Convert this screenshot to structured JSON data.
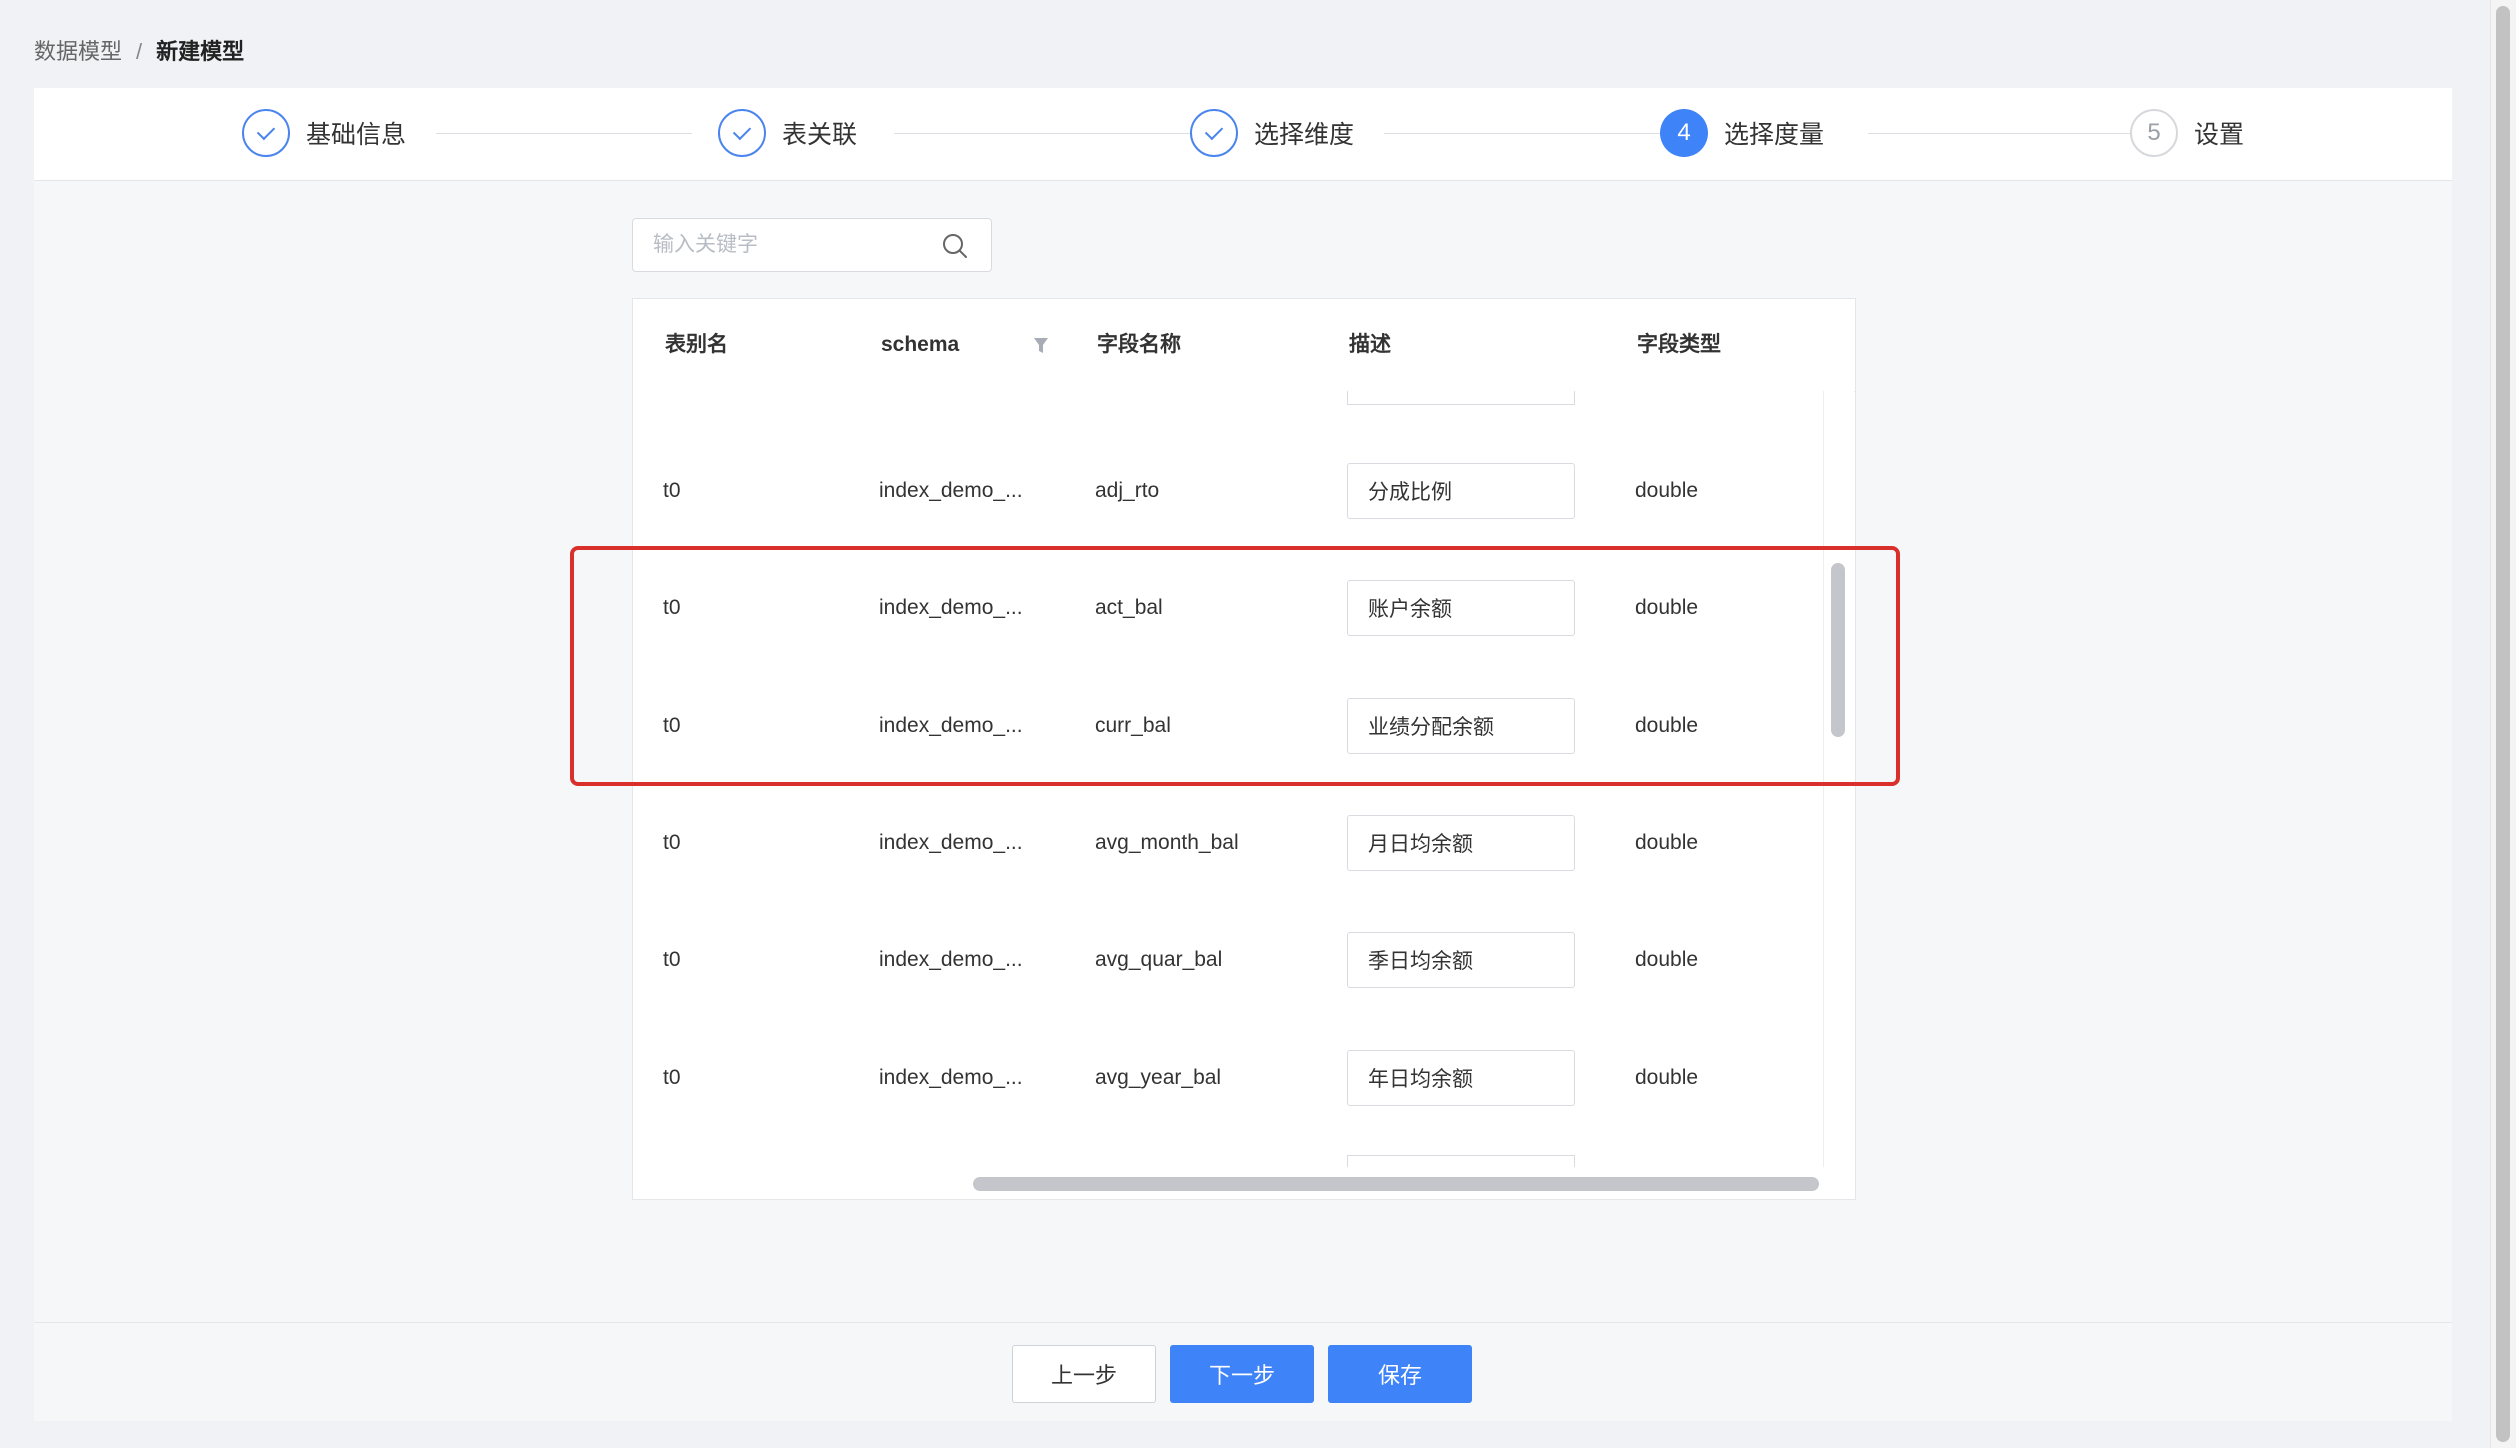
{
  "breadcrumb": {
    "parent": "数据模型",
    "separator": "/",
    "current": "新建模型"
  },
  "steps": [
    {
      "number": "1",
      "label": "基础信息",
      "state": "done"
    },
    {
      "number": "2",
      "label": "表关联",
      "state": "done"
    },
    {
      "number": "3",
      "label": "选择维度",
      "state": "done"
    },
    {
      "number": "4",
      "label": "选择度量",
      "state": "active"
    },
    {
      "number": "5",
      "label": "设置",
      "state": "todo"
    }
  ],
  "search": {
    "placeholder": "输入关键字",
    "value": ""
  },
  "table": {
    "headers": [
      "表别名",
      "schema",
      "字段名称",
      "描述",
      "字段类型"
    ],
    "rows": [
      {
        "alias": "t0",
        "schema": "index_demo_...",
        "field": "adj_rto",
        "desc": "分成比例",
        "type": "double"
      },
      {
        "alias": "t0",
        "schema": "index_demo_...",
        "field": "act_bal",
        "desc": "账户余额",
        "type": "double"
      },
      {
        "alias": "t0",
        "schema": "index_demo_...",
        "field": "curr_bal",
        "desc": "业绩分配余额",
        "type": "double"
      },
      {
        "alias": "t0",
        "schema": "index_demo_...",
        "field": "avg_month_bal",
        "desc": "月日均余额",
        "type": "double"
      },
      {
        "alias": "t0",
        "schema": "index_demo_...",
        "field": "avg_quar_bal",
        "desc": "季日均余额",
        "type": "double"
      },
      {
        "alias": "t0",
        "schema": "index_demo_...",
        "field": "avg_year_bal",
        "desc": "年日均余额",
        "type": "double"
      }
    ]
  },
  "footer": {
    "prev": "上一步",
    "next": "下一步",
    "save": "保存"
  },
  "colors": {
    "primary": "#3f83f8",
    "highlight": "#d9302c"
  }
}
